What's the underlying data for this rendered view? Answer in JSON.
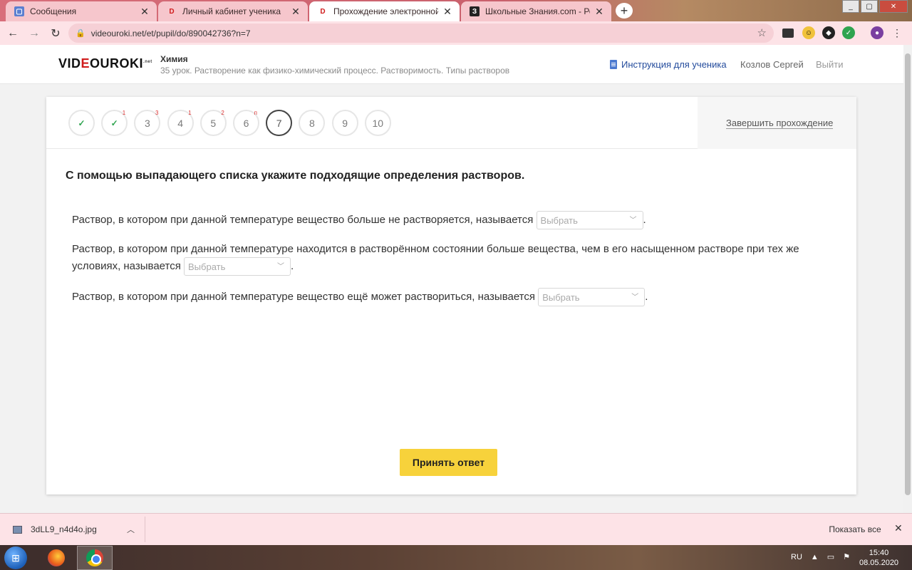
{
  "browser": {
    "tabs": [
      {
        "title": "Сообщения",
        "favicon": "message-icon",
        "active": false
      },
      {
        "title": "Личный кабинет ученика",
        "favicon": "videouroki-icon",
        "active": false
      },
      {
        "title": "Прохождение электронной тетради",
        "favicon": "videouroki-icon",
        "active": true
      },
      {
        "title": "Школьные Знания.com - Решае",
        "favicon": "znanija-icon",
        "active": false
      }
    ],
    "url": "videouroki.net/et/pupil/do/890042736?n=7"
  },
  "header": {
    "logo_prefix": "VID",
    "logo_accent": "E",
    "logo_suffix": "OUROKI",
    "logo_tld": ".net",
    "subject": "Химия",
    "lesson": "35 урок. Растворение как физико-химический процесс. Растворимость. Типы растворов",
    "instruction_link": "Инструкция для ученика",
    "user_name": "Козлов Сергей",
    "logout": "Выйти"
  },
  "questions": [
    {
      "label": "1",
      "state": "done",
      "badge": ""
    },
    {
      "label": "2",
      "state": "done",
      "badge": "1"
    },
    {
      "label": "3",
      "state": "pending",
      "badge": "3"
    },
    {
      "label": "4",
      "state": "pending",
      "badge": "1"
    },
    {
      "label": "5",
      "state": "pending",
      "badge": "2"
    },
    {
      "label": "6",
      "state": "pending",
      "badge": "п"
    },
    {
      "label": "7",
      "state": "current",
      "badge": ""
    },
    {
      "label": "8",
      "state": "pending",
      "badge": ""
    },
    {
      "label": "9",
      "state": "pending",
      "badge": ""
    },
    {
      "label": "10",
      "state": "pending",
      "badge": ""
    }
  ],
  "finish_label": "Завершить прохождение",
  "task": {
    "instruction": "С помощью выпадающего списка укажите подходящие определения растворов.",
    "items": [
      {
        "text": "Раствор, в котором при данной температуре вещество больше не растворяется, называется",
        "select_placeholder": "Выбрать",
        "suffix": "."
      },
      {
        "text": "Раствор, в котором при данной температуре находится в растворённом состоянии больше вещества, чем в его насыщенном растворе при тех же условиях, называется",
        "select_placeholder": "Выбрать",
        "suffix": "."
      },
      {
        "text": "Раствор, в котором при данной температуре вещество ещё может раствориться, называется",
        "select_placeholder": "Выбрать",
        "suffix": "."
      }
    ],
    "submit_label": "Принять ответ"
  },
  "downloads": {
    "file_name": "3dLL9_n4d4o.jpg",
    "show_all": "Показать все"
  },
  "taskbar": {
    "language": "RU",
    "time": "15:40",
    "date": "08.05.2020"
  },
  "colors": {
    "accent_yellow": "#f7d23b",
    "logo_red": "#d01c1c",
    "link_blue": "#234b9c",
    "check_green": "#2ea44f"
  }
}
